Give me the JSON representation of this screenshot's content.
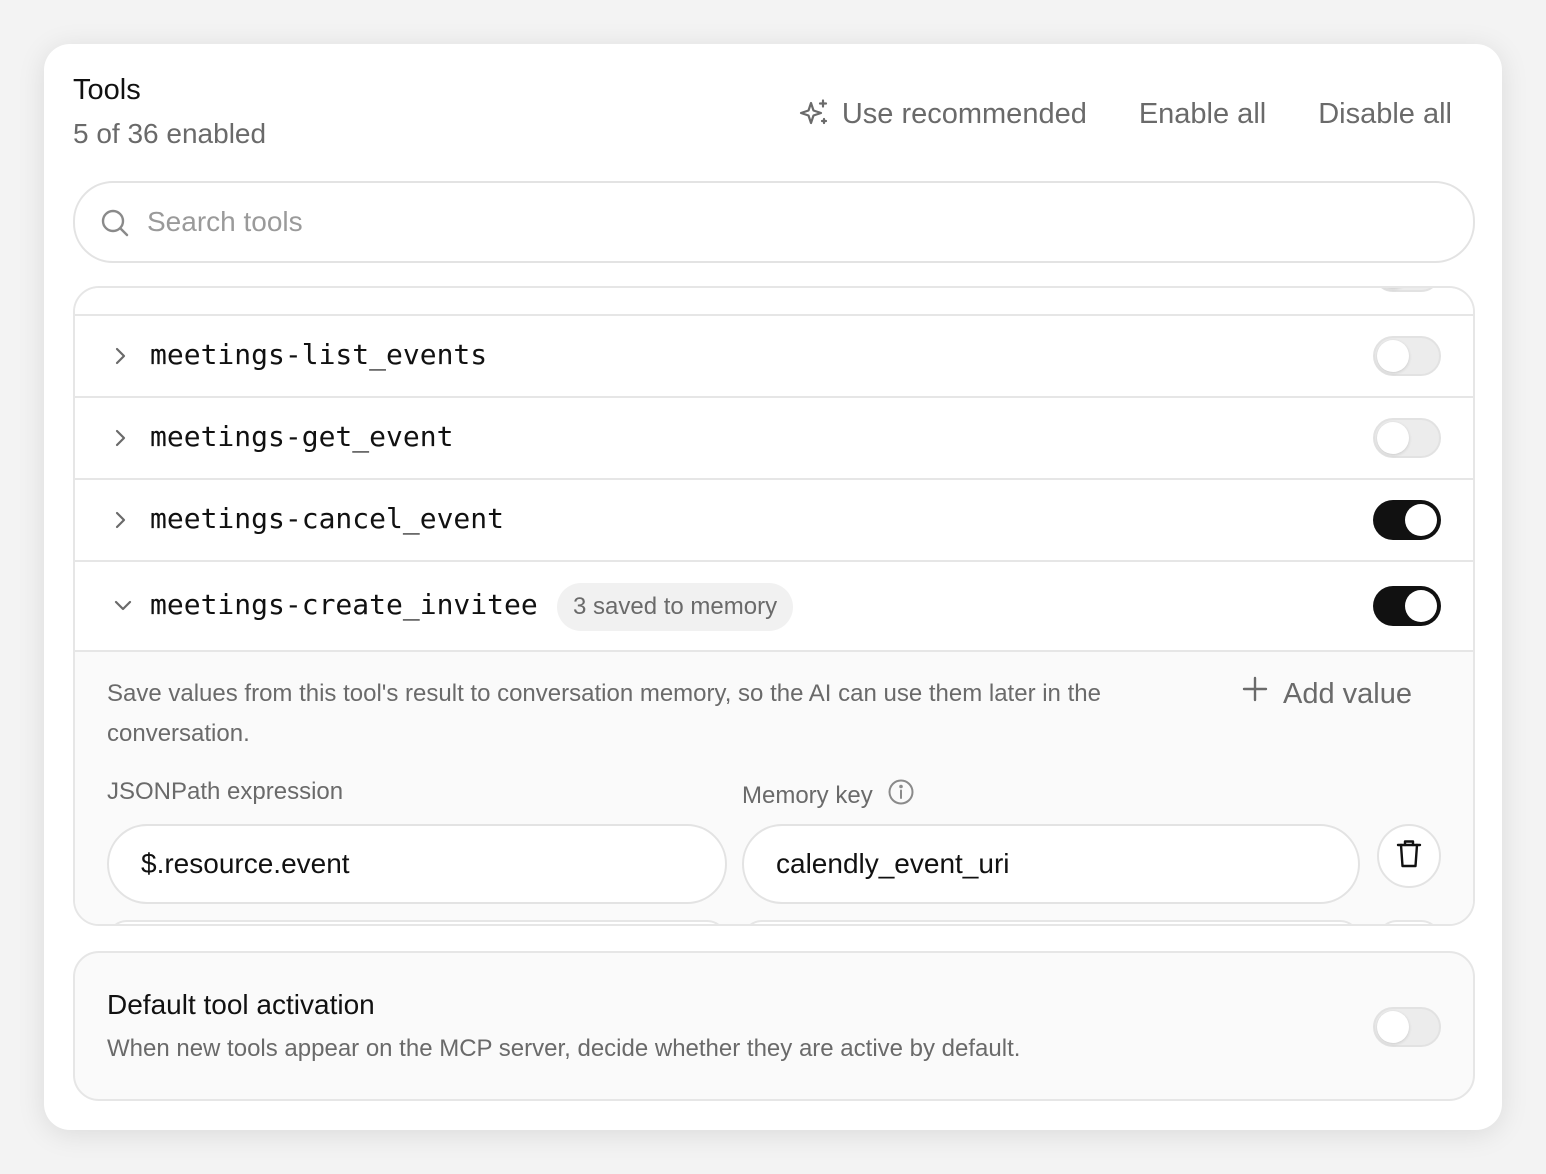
{
  "header": {
    "title": "Tools",
    "subtitle": "5 of 36 enabled",
    "use_recommended_label": "Use recommended",
    "enable_all_label": "Enable all",
    "disable_all_label": "Disable all"
  },
  "search": {
    "placeholder": "Search tools",
    "value": ""
  },
  "tools": [
    {
      "name": "meetings-list_events",
      "enabled": false,
      "expanded": false
    },
    {
      "name": "meetings-get_event",
      "enabled": false,
      "expanded": false
    },
    {
      "name": "meetings-cancel_event",
      "enabled": true,
      "expanded": false
    },
    {
      "name": "meetings-create_invitee",
      "enabled": true,
      "expanded": true,
      "badge": "3 saved to memory"
    }
  ],
  "memory_panel": {
    "description": "Save values from this tool's result to conversation memory, so the AI can use them later in the conversation.",
    "add_value_label": "Add value",
    "jsonpath_label": "JSONPath expression",
    "memory_key_label": "Memory key",
    "entries": [
      {
        "jsonpath": "$.resource.event",
        "memory_key": "calendly_event_uri"
      }
    ]
  },
  "default_activation": {
    "title": "Default tool activation",
    "description": "When new tools appear on the MCP server, decide whether they are active by default.",
    "enabled": false
  },
  "colors": {
    "toggle_on": "#111111",
    "toggle_off": "#ececec",
    "muted_text": "#6a6a6a"
  },
  "icons": {
    "use_recommended": "sparkle-icon",
    "search": "search-icon",
    "collapsed": "chevron-right-icon",
    "expanded": "chevron-down-icon",
    "add": "plus-icon",
    "info": "info-icon",
    "delete": "trash-icon"
  }
}
